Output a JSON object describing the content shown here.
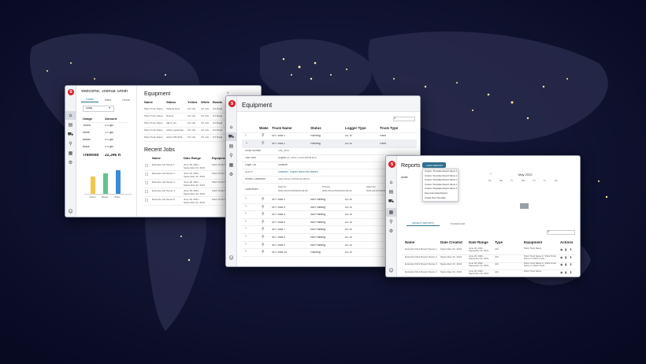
{
  "colors": {
    "brand": "#d8232a",
    "accent": "#2d6f8e",
    "bar_green": "#5fc48a",
    "bar_yellow": "#f3c54a",
    "bar_blue": "#3b8bd6"
  },
  "win1": {
    "welcome": "Welcome, Joshua Smith",
    "tabs": [
      "Loads",
      "Miles",
      "Hours"
    ],
    "period": "Today",
    "usage_headers": [
      "Usage",
      "Amount"
    ],
    "usage": [
      [
        "Yellow",
        "0.0 gal"
      ],
      [
        "White",
        "1.2 gal"
      ],
      [
        "Beads",
        "0.0 gal"
      ],
      [
        "Black",
        "0.0 gal"
      ]
    ],
    "traveled_label": "Traveled",
    "traveled_value": "22,346 ft",
    "chart_legend": [
      "Yellow",
      "Beads",
      "White"
    ],
    "equipment_title": "Equipment",
    "eq_headers": [
      "Name",
      "Status",
      "Yellow",
      "White",
      "Beads"
    ],
    "eq_rows": [
      [
        "Paint Truck Name",
        "Parking Now",
        "0.0 mils",
        "0.0 mils",
        "0.0 lb/gal"
      ],
      [
        "Paint Truck Name",
        "Driving",
        "0.0 mils",
        "0.0 mils",
        "0.0 lb/gal"
      ],
      [
        "Paint Truck Name",
        "Idle 5 min",
        "0.0 mils",
        "0.0 mils",
        "0.0 lb/gal"
      ],
      [
        "Paint Truck Name",
        "Active yesterday",
        "0.0 mils",
        "0.0 mils",
        "0.0 lb/gal"
      ],
      [
        "Paint Truck Name",
        "Active 05/15/21",
        "0.0 mils",
        "0.0 mils",
        "0.0 lb/gal"
      ]
    ],
    "recent_title": "Recent Jobs",
    "rj_headers": [
      "Name",
      "Date Range",
      "Equipment"
    ],
    "rj_rows": [
      [
        "Example Job Name 1",
        "June 18, 2021 - September 22, 2021",
        "Paint Truck Name"
      ],
      [
        "Example Job Name 2",
        "June 16, 2021 - September 22, 2021",
        "Paint Truck Name"
      ],
      [
        "Example Job Name 3",
        "June 18, 2021 - September 22, 2021",
        "Paint Truck Name"
      ],
      [
        "Example Job Name 4",
        "June 18, 2021 - September 22, 2021",
        "Paint Truck Name"
      ],
      [
        "Example Job Name 5",
        "June 18, 2021 - September 22, 2021",
        "Paint Truck Name"
      ]
    ]
  },
  "win2": {
    "title": "Equipment",
    "headers": [
      "Wake",
      "Truck Name",
      "Status",
      "Logger Type",
      "Truck Type"
    ],
    "row1": [
      "SR Truck 1",
      "Painting",
      "DL-III",
      "Paint"
    ],
    "row2": [
      "SR Truck 2",
      "Painting",
      "DL-III",
      "Paint"
    ],
    "details": [
      [
        "Serial Number",
        "CSL_R2X"
      ],
      [
        "Last Used",
        "August 22, 2022, 12:00:00PM EDT"
      ],
      [
        "Eagle Cat",
        "Disabled"
      ],
      [
        "SLSTP",
        "Disabled - Inquire about this feature"
      ],
      [
        "Recent Calibration",
        "2021-05-10T00:00:00-04:00"
      ]
    ],
    "calib_label": "Calibrations",
    "calib_cols": [
      "Paint Ip",
      "Primary",
      "Paint Op"
    ],
    "rows": [
      [
        "SR Truck 3",
        "Not Painting",
        "DL-III"
      ],
      [
        "SR Truck 4",
        "Not Painting",
        "DL-III"
      ],
      [
        "SR Truck 5",
        "Not Painting",
        "DL-III"
      ],
      [
        "SR Truck 6",
        "Not Painting",
        "DL-III"
      ],
      [
        "SR Truck 7",
        "Not Painting",
        "DL-III"
      ],
      [
        "SR Truck 8",
        "Not Painting",
        "DL-III"
      ],
      [
        "SR Truck 9",
        "Not Painting",
        "DL-III"
      ],
      [
        "SR Truck 10",
        "Painting",
        "DL-III"
      ]
    ]
  },
  "win3": {
    "title": "Reports",
    "new_report": "+ NEW REPORT",
    "menu": [
      "Custom Template Report Name 1",
      "Custom Template Report Name 2",
      "Custom Template Report Name 3",
      "Custom Template Report Name 4",
      "Custom Template Report Name 5",
      "New Automated Report",
      "Create New Template"
    ],
    "tabs": [
      "RECENT REPORTS",
      "SCHEDULED"
    ],
    "month": "May 2022",
    "weekdays": [
      "Su",
      "Mo",
      "Tu",
      "We",
      "Th",
      "Fr",
      "Sa"
    ],
    "headers": [
      "Name",
      "Date Created",
      "Date Range",
      "Type",
      "Equipment",
      "Actions"
    ],
    "rows": [
      [
        "Example Paint Report Name 1",
        "September 22, 2021",
        "June 18, 2021 - September 22, 2021",
        "Job",
        "Paint Truck Name"
      ],
      [
        "Example Paint Report Name 2",
        "September 22, 2021",
        "June 18, 2021 - September 22, 2021",
        "Job",
        "Paint Truck Name 1 | Paint Truck Name 2 | Paint Truck..."
      ],
      [
        "Example Paint Report Name 3",
        "September 22, 2021",
        "June 18, 2021 - September 22, 2021",
        "Job",
        "Paint Truck Name 1 | Paint Truck Name 2 | Paint Truck..."
      ],
      [
        "Example Paint Report Name 4",
        "September 22, 2021",
        "June 18, 2021 - September 22, 2021",
        "Job",
        "Paint Truck Name"
      ]
    ]
  }
}
